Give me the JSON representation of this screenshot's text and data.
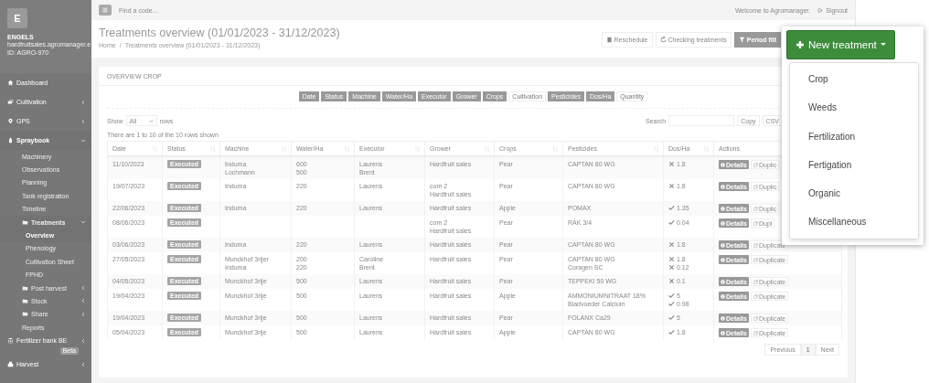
{
  "sidebar": {
    "logo": "E",
    "user": "ENGELS",
    "email": "hardfruitsales.agromanager.e",
    "id": "ID: AGRO-970",
    "items": [
      {
        "label": "Dashboard",
        "kind": "section",
        "selected": false
      },
      {
        "label": "Cultivation",
        "kind": "section",
        "selected": false,
        "expanded": false
      },
      {
        "label": "GPS",
        "kind": "section",
        "selected": false,
        "expanded": false
      },
      {
        "label": "Spraybook",
        "kind": "section",
        "selected": true,
        "expanded": true,
        "children": [
          {
            "label": "Machinery",
            "kind": "page",
            "selected": false
          },
          {
            "label": "Observations",
            "kind": "page",
            "selected": false
          },
          {
            "label": "Planning",
            "kind": "page",
            "selected": false
          },
          {
            "label": "Tank registration",
            "kind": "page",
            "selected": false
          },
          {
            "label": "Timeline",
            "kind": "page",
            "selected": false
          },
          {
            "label": "Treatments",
            "kind": "folder",
            "selected": true,
            "expanded": true,
            "children": [
              {
                "label": "Overview",
                "kind": "page",
                "selected": true
              },
              {
                "label": "Phenology",
                "kind": "page",
                "selected": false
              },
              {
                "label": "Cultivation Sheet",
                "kind": "page",
                "selected": false
              },
              {
                "label": "FPHD",
                "kind": "page",
                "selected": false
              }
            ]
          },
          {
            "label": "Post harvest",
            "kind": "folder",
            "selected": false,
            "expanded": false
          },
          {
            "label": "Stock",
            "kind": "folder",
            "selected": false,
            "expanded": false
          },
          {
            "label": "Share",
            "kind": "folder",
            "selected": false,
            "expanded": false
          },
          {
            "label": "Reports",
            "kind": "page",
            "selected": false
          }
        ]
      },
      {
        "label": "Fertilizer bank BE",
        "kind": "section",
        "selected": false,
        "expanded": false,
        "badge": "Beta"
      },
      {
        "label": "Harvest",
        "kind": "section",
        "selected": false,
        "expanded": false
      }
    ]
  },
  "topbar": {
    "search_placeholder": "Find a code...",
    "welcome": "Welcome to Agromanager.",
    "signout": "Signout"
  },
  "header": {
    "title": "Treatments overview (01/01/2023 - 31/12/2023)",
    "breadcrumb": [
      "Home",
      "Treatments overview (01/01/2023 - 31/12/2023)"
    ],
    "breadcrumb_separator": "/",
    "buttons": [
      {
        "label": "Reschedule",
        "kind": "outline"
      },
      {
        "label": "Checking treatments",
        "kind": "outline"
      },
      {
        "label": "Period filt",
        "kind": "filled"
      }
    ]
  },
  "card": {
    "title": "OVERVIEW CROP",
    "column_toggles": [
      {
        "label": "Date",
        "selected": true
      },
      {
        "label": "Status",
        "selected": true
      },
      {
        "label": "Machine",
        "selected": true
      },
      {
        "label": "Water/Ha",
        "selected": true
      },
      {
        "label": "Executor",
        "selected": true
      },
      {
        "label": "Grower",
        "selected": true
      },
      {
        "label": "Crops",
        "selected": true
      },
      {
        "label": "Cultivation",
        "selected": false
      },
      {
        "label": "Pesticides",
        "selected": true
      },
      {
        "label": "Dos/Ha",
        "selected": true
      },
      {
        "label": "Quantity",
        "selected": false
      }
    ],
    "show_label": "Show",
    "show_value": "All",
    "rows_label": "rows",
    "search_label": "Search",
    "export_buttons": [
      "Copy",
      "CSV"
    ],
    "info": "There are 1 to 10 of the 10 rows shown",
    "columns": [
      "Date",
      "Status",
      "Machine",
      "Water/Ha",
      "Executor",
      "Grower",
      "Crops",
      "Pesticides",
      "Dos/Ha",
      "Actions"
    ],
    "rows": [
      {
        "date": "11/10/2023",
        "status": "Executed",
        "machine": [
          "Induma",
          "Lochmann"
        ],
        "water": [
          "600",
          "500"
        ],
        "executor": [
          "Laurens",
          "Brent"
        ],
        "grower": [
          "Hardfruit sales"
        ],
        "crop": "Pear",
        "pesticides": [
          "CAPTAN 80 WG"
        ],
        "doses": [
          {
            "value": "1.8",
            "ok": false
          }
        ],
        "details": "Details",
        "duplicate": "Duplic"
      },
      {
        "date": "19/07/2023",
        "status": "Executed",
        "machine": [
          "Induma"
        ],
        "water": [
          "220"
        ],
        "executor": [
          "Laurens"
        ],
        "grower": [
          "com 2",
          "Hardfruit sales"
        ],
        "crop": "Pear",
        "pesticides": [
          "CAPTAN 80 WG"
        ],
        "doses": [
          {
            "value": "1.8",
            "ok": false
          }
        ],
        "details": "Details",
        "duplicate": "Duplic"
      },
      {
        "date": "22/06/2023",
        "status": "Executed",
        "machine": [
          "Induma"
        ],
        "water": [
          "220"
        ],
        "executor": [
          "Laurens"
        ],
        "grower": [
          "Hardfruit sales"
        ],
        "crop": "Apple",
        "pesticides": [
          "POMAX"
        ],
        "doses": [
          {
            "value": "1.35",
            "ok": true
          }
        ],
        "details": "Details",
        "duplicate": "Duplic"
      },
      {
        "date": "08/06/2023",
        "status": "Executed",
        "machine": [],
        "water": [],
        "executor": [],
        "grower": [
          "com 2",
          "Hardfruit sales"
        ],
        "crop": "Pear",
        "pesticides": [
          "RAK 3/4"
        ],
        "doses": [
          {
            "value": "0.04",
            "ok": true
          }
        ],
        "details": "Details",
        "duplicate": "Dupl"
      },
      {
        "date": "03/06/2023",
        "status": "Executed",
        "machine": [
          "Induma"
        ],
        "water": [
          "220"
        ],
        "executor": [
          "Laurens"
        ],
        "grower": [
          "Hardfruit sales"
        ],
        "crop": "Pear",
        "pesticides": [
          "CAPTAN 80 WG"
        ],
        "doses": [
          {
            "value": "1.8",
            "ok": false
          }
        ],
        "details": "Details",
        "duplicate": "Duplicate"
      },
      {
        "date": "27/05/2023",
        "status": "Executed",
        "machine": [
          "Munckhof 3rijer",
          "Induma"
        ],
        "water": [
          "200",
          "220"
        ],
        "executor": [
          "Caroline",
          "Brent"
        ],
        "grower": [
          "Hardfruit sales"
        ],
        "crop": "Pear",
        "pesticides": [
          "CAPTAN 80 WG",
          "Coragen SC"
        ],
        "doses": [
          {
            "value": "1.8",
            "ok": false
          },
          {
            "value": "0.12",
            "ok": false
          }
        ],
        "details": "Details",
        "duplicate": "Duplicate"
      },
      {
        "date": "04/05/2023",
        "status": "Executed",
        "machine": [
          "Munckhof 3rije"
        ],
        "water": [
          "500"
        ],
        "executor": [
          "Laurens"
        ],
        "grower": [
          "Hardfruit sales"
        ],
        "crop": "Pear",
        "pesticides": [
          "TEPPEKI 50 WG"
        ],
        "doses": [
          {
            "value": "0.1",
            "ok": false
          }
        ],
        "details": "Details",
        "duplicate": "Duplicate"
      },
      {
        "date": "19/04/2023",
        "status": "Executed",
        "machine": [
          "Munckhof 3rije"
        ],
        "water": [
          "500"
        ],
        "executor": [
          "Laurens"
        ],
        "grower": [
          "Hardfruit sales"
        ],
        "crop": "Apple",
        "pesticides": [
          "AMMONIUMNITRAAT 18%",
          "Bladvoeder Calcium"
        ],
        "doses": [
          {
            "value": "5",
            "ok": true
          },
          {
            "value": "0.98",
            "ok": true
          }
        ],
        "details": "Details",
        "duplicate": "Duplicate"
      },
      {
        "date": "19/04/2023",
        "status": "Executed",
        "machine": [
          "Munckhof 3rije"
        ],
        "water": [
          "500"
        ],
        "executor": [
          "Laurens"
        ],
        "grower": [
          "Hardfruit sales"
        ],
        "crop": "Pear",
        "pesticides": [
          "FOLANX Ca29"
        ],
        "doses": [
          {
            "value": "5",
            "ok": true
          }
        ],
        "details": "Details",
        "duplicate": "Duplicate"
      },
      {
        "date": "05/04/2023",
        "status": "Executed",
        "machine": [
          "Munckhof 3rije"
        ],
        "water": [
          "500"
        ],
        "executor": [
          "Laurens"
        ],
        "grower": [
          "Hardfruit sales"
        ],
        "crop": "Apple",
        "pesticides": [
          "CAPTAN 80 WG"
        ],
        "doses": [
          {
            "value": "1.8",
            "ok": true
          }
        ],
        "details": "Details",
        "duplicate": "Duplicate"
      }
    ],
    "pagination": [
      {
        "label": "Previous",
        "kind": "nav"
      },
      {
        "label": "1",
        "kind": "page"
      },
      {
        "label": "Next",
        "kind": "nav"
      }
    ]
  },
  "new_treatment": {
    "label": "New treatment",
    "options": [
      "Crop",
      "Weeds",
      "Fertilization",
      "Fertigation",
      "Organic",
      "Miscellaneous"
    ]
  }
}
